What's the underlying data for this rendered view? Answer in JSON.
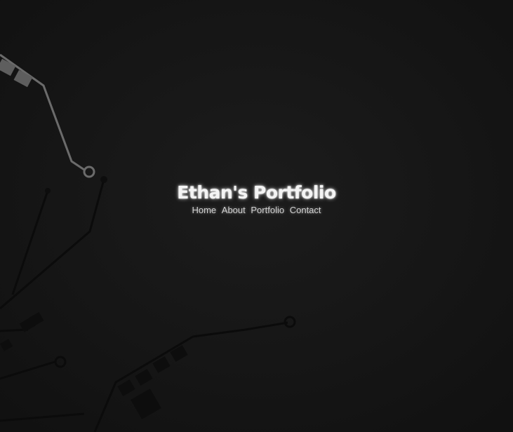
{
  "site": {
    "title": "Ethan's Portfolio"
  },
  "nav": {
    "items": [
      {
        "label": "Home"
      },
      {
        "label": "About"
      },
      {
        "label": "Portfolio"
      },
      {
        "label": "Contact"
      }
    ]
  },
  "colors": {
    "background": "#171717",
    "circuit_light": "#6e6e6e",
    "circuit_dark": "#0c0c0c",
    "title_text": "#f4f4f4",
    "nav_text": "#d2d2d2"
  }
}
